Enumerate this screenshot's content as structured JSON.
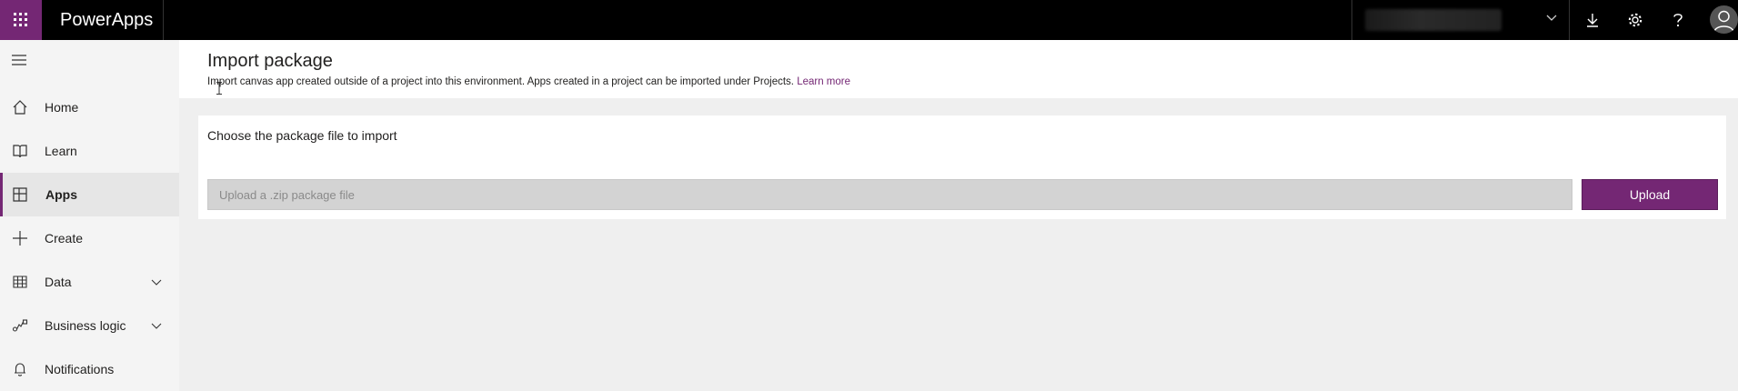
{
  "app": {
    "name": "PowerApps",
    "brand_color": "#742774"
  },
  "topbar": {
    "icons": [
      "app-launcher-icon",
      "chevron-down-icon",
      "download-icon",
      "gear-icon",
      "help-icon",
      "avatar-icon"
    ]
  },
  "nav": {
    "items": [
      {
        "label": "Home",
        "icon": "home-icon"
      },
      {
        "label": "Learn",
        "icon": "book-icon"
      },
      {
        "label": "Apps",
        "icon": "apps-icon",
        "active": true
      },
      {
        "label": "Create",
        "icon": "plus-icon"
      },
      {
        "label": "Data",
        "icon": "table-icon",
        "expandable": true
      },
      {
        "label": "Business logic",
        "icon": "flow-icon",
        "expandable": true
      },
      {
        "label": "Notifications",
        "icon": "bell-icon"
      }
    ]
  },
  "page": {
    "title": "Import package",
    "description": "Import canvas app created outside of a project into this environment. Apps created in a project can be imported under Projects.",
    "learn_more": "Learn more"
  },
  "upload_card": {
    "title": "Choose the package file to import",
    "input_placeholder": "Upload a .zip package file",
    "input_value": "",
    "button_label": "Upload"
  }
}
